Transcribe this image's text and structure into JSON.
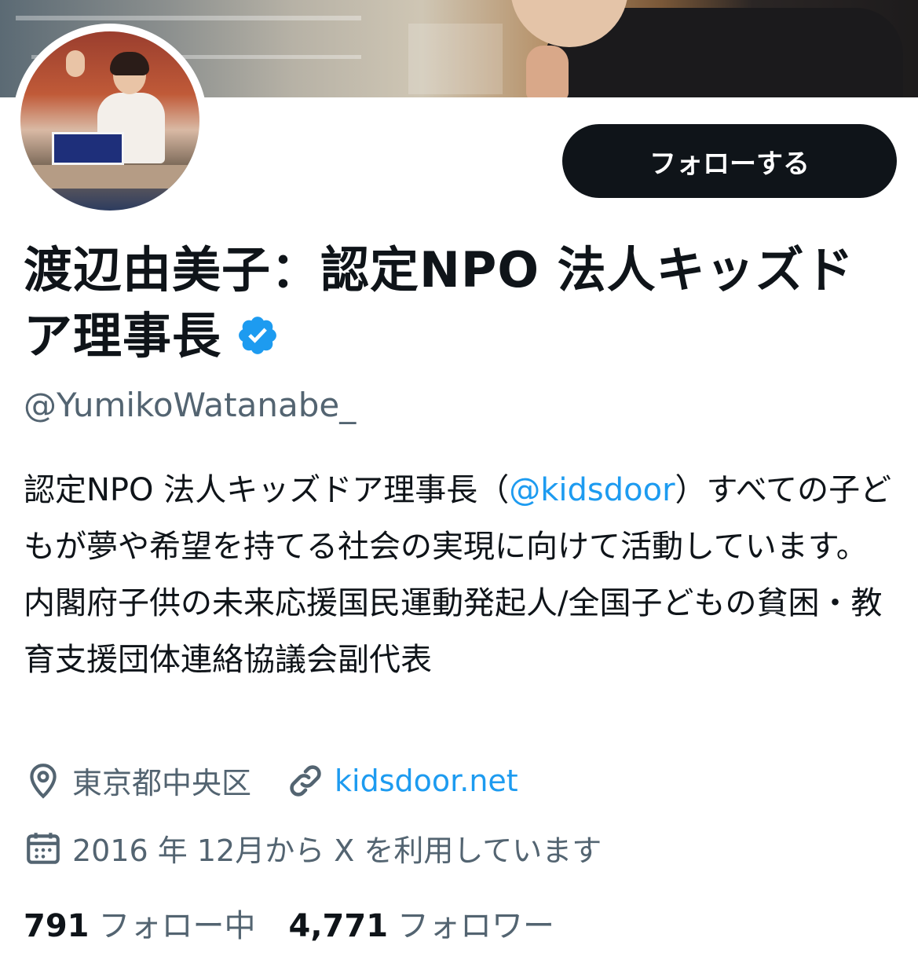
{
  "profile": {
    "follow_label": "フォローする",
    "display_name": "渡辺由美子：認定NPO 法人キッズドア理事長",
    "handle": "@YumikoWatanabe_",
    "bio_prefix": "認定NPO 法人キッズドア理事長（",
    "bio_mention": "@kidsdoor",
    "bio_rest": "）すべての子どもが夢や希望を持てる社会の実現に向けて活動しています。 内閣府子供の未来応援国民運動発起人/全国子どもの貧困・教育支援団体連絡協議会副代表",
    "location": "東京都中央区",
    "website": "kidsdoor.net",
    "joined": "2016 年 12月から X を利用しています",
    "following_count": "791",
    "following_label": "フォロー中",
    "followers_count": "4,771",
    "followers_label": "フォロワー"
  },
  "icons": {
    "verified": "verified-badge-icon",
    "location": "location-pin-icon",
    "link": "link-icon",
    "calendar": "calendar-icon"
  },
  "colors": {
    "text": "#0f1419",
    "secondary": "#536471",
    "accent": "#1d9bf0",
    "button_bg": "#0f1419"
  }
}
